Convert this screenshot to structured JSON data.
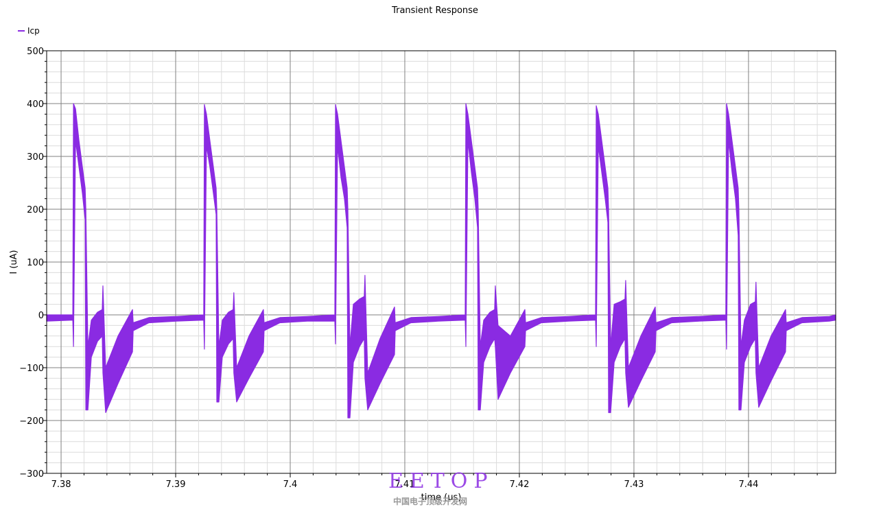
{
  "chart_data": {
    "type": "line",
    "title": "Transient Response",
    "xlabel": "time (us)",
    "ylabel": "I (uA)",
    "xlim": [
      7.37874,
      7.44761
    ],
    "ylim": [
      -300,
      500
    ],
    "x_ticks": [
      7.38,
      7.39,
      7.4,
      7.41,
      7.42,
      7.43,
      7.44
    ],
    "x_tick_labels": [
      "7.38",
      "7.39",
      "7.4",
      "7.41",
      "7.42",
      "7.43",
      "7.44"
    ],
    "y_ticks": [
      -300,
      -200,
      -100,
      0,
      100,
      200,
      300,
      400,
      500
    ],
    "y_tick_labels": [
      "−300",
      "−200",
      "−100",
      "0",
      "100",
      "200",
      "300",
      "400",
      "500"
    ],
    "grid": true,
    "legend_position": "top-left",
    "series": [
      {
        "name": "Icp",
        "color": "#8a2be2",
        "t": [
          7.37874,
          7.38102,
          7.38108,
          7.38126,
          7.38156,
          7.38186,
          7.3821,
          7.38216,
          7.38234,
          7.38264,
          7.38318,
          7.38359,
          7.38365,
          7.38389,
          7.38497,
          7.38623,
          7.38629,
          7.38767,
          7.39006,
          7.39245,
          7.39251,
          7.39269,
          7.39299,
          7.39329,
          7.39353,
          7.39359,
          7.39377,
          7.39407,
          7.39461,
          7.39502,
          7.39508,
          7.39532,
          7.3964,
          7.39766,
          7.39772,
          7.3991,
          7.40149,
          7.40389,
          7.40395,
          7.40413,
          7.40443,
          7.40473,
          7.40497,
          7.40503,
          7.40521,
          7.40551,
          7.40605,
          7.40646,
          7.40652,
          7.40676,
          7.40784,
          7.4091,
          7.40916,
          7.41054,
          7.41293,
          7.41527,
          7.41533,
          7.41551,
          7.41581,
          7.41611,
          7.41635,
          7.41641,
          7.41659,
          7.41689,
          7.41743,
          7.41784,
          7.4179,
          7.41814,
          7.41922,
          7.42048,
          7.42054,
          7.42192,
          7.42431,
          7.42665,
          7.42671,
          7.42689,
          7.42719,
          7.42749,
          7.42773,
          7.42779,
          7.42797,
          7.42827,
          7.42881,
          7.42922,
          7.42928,
          7.42952,
          7.4306,
          7.43186,
          7.43192,
          7.4333,
          7.43569,
          7.43802,
          7.43808,
          7.43826,
          7.43856,
          7.43886,
          7.4391,
          7.43916,
          7.43934,
          7.43964,
          7.44018,
          7.44059,
          7.44065,
          7.44089,
          7.44197,
          7.44323,
          7.44329,
          7.44467,
          7.44706,
          7.44761
        ],
        "min": [
          -12,
          -10,
          -60,
          330,
          280,
          230,
          180,
          -180,
          -180,
          -80,
          -50,
          -40,
          -110,
          -185,
          -130,
          -70,
          -30,
          -15,
          -12,
          -10,
          -65,
          320,
          280,
          230,
          190,
          -165,
          -165,
          -80,
          -55,
          -45,
          -110,
          -165,
          -120,
          -70,
          -30,
          -15,
          -12,
          -12,
          -55,
          320,
          260,
          220,
          165,
          -195,
          -195,
          -90,
          -60,
          -45,
          -120,
          -180,
          -130,
          -75,
          -30,
          -15,
          -12,
          -10,
          -60,
          330,
          270,
          220,
          165,
          -180,
          -180,
          -90,
          -60,
          -45,
          -60,
          -160,
          -110,
          -60,
          -30,
          -15,
          -12,
          -10,
          -60,
          320,
          270,
          220,
          175,
          -185,
          -185,
          -90,
          -60,
          -45,
          -110,
          -175,
          -125,
          -70,
          -30,
          -15,
          -12,
          -10,
          -65,
          330,
          270,
          220,
          150,
          -180,
          -180,
          -90,
          -60,
          -45,
          -110,
          -175,
          -125,
          -70,
          -30,
          -15,
          -12,
          -10
        ],
        "max": [
          0,
          0,
          400,
          390,
          330,
          280,
          240,
          200,
          -60,
          -10,
          5,
          10,
          55,
          -100,
          -40,
          10,
          -15,
          -5,
          -3,
          0,
          398,
          380,
          330,
          280,
          240,
          200,
          -60,
          -10,
          5,
          10,
          42,
          -100,
          -40,
          10,
          -15,
          -5,
          -3,
          0,
          398,
          380,
          330,
          280,
          240,
          200,
          -60,
          20,
          30,
          35,
          75,
          -110,
          -45,
          15,
          -15,
          -5,
          -3,
          0,
          400,
          380,
          330,
          280,
          240,
          200,
          -60,
          -10,
          5,
          10,
          55,
          -20,
          -40,
          10,
          -15,
          -5,
          -3,
          0,
          396,
          380,
          330,
          280,
          240,
          200,
          -60,
          20,
          25,
          30,
          65,
          -100,
          -40,
          15,
          -15,
          -5,
          -3,
          0,
          400,
          380,
          330,
          280,
          240,
          200,
          -60,
          -10,
          20,
          25,
          62,
          -100,
          -40,
          10,
          -15,
          -5,
          -3,
          0
        ]
      }
    ]
  },
  "watermark": {
    "logo": "EETOP",
    "subtitle": "中国电子顶级开发网"
  }
}
